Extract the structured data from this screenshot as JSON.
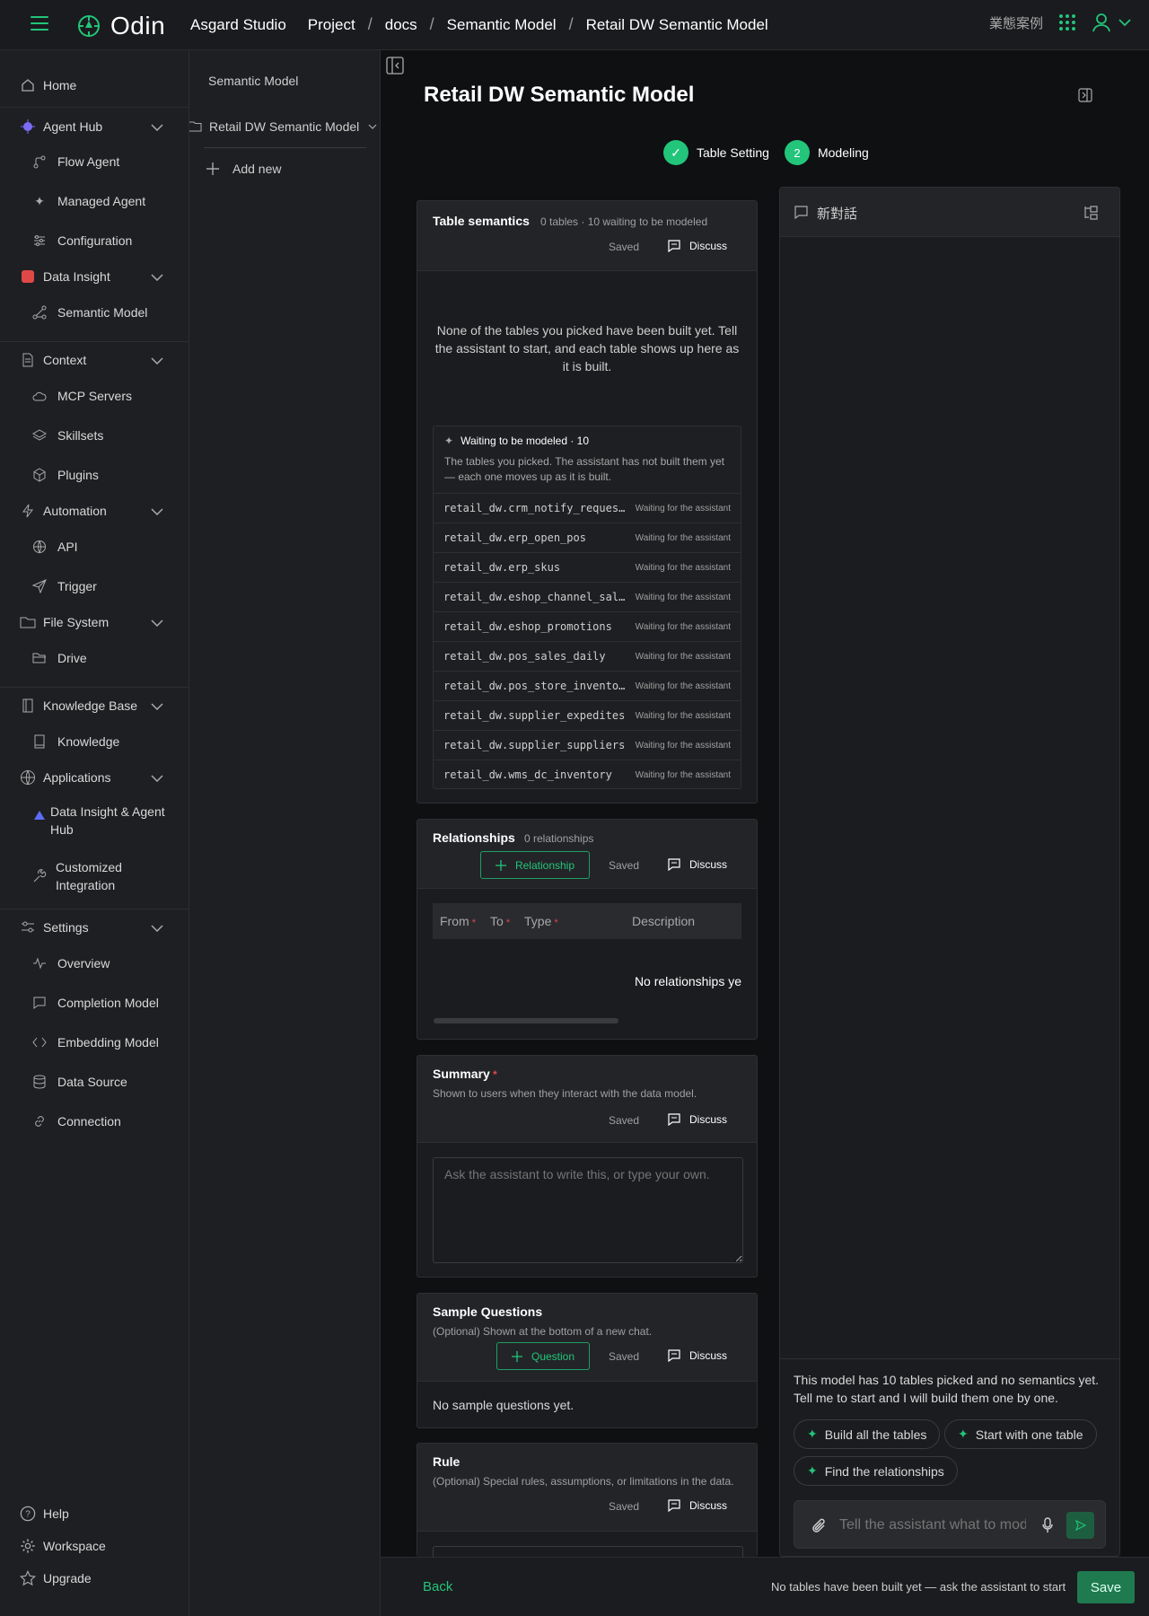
{
  "header": {
    "brand": "Odin",
    "studio": "Asgard Studio",
    "breadcrumbs": [
      "Project",
      "docs",
      "Semantic Model",
      "Retail DW Semantic Model"
    ],
    "right_label": "業態案例"
  },
  "sidebar": {
    "items": [
      {
        "label": "Home",
        "icon": "home-icon"
      },
      {
        "label": "Agent Hub",
        "icon": "agent-hub-icon"
      },
      {
        "label": "Flow Agent",
        "icon": "flow-icon"
      },
      {
        "label": "Managed Agent",
        "icon": "sparkle-icon"
      },
      {
        "label": "Configuration",
        "icon": "sliders-icon"
      },
      {
        "label": "Data Insight",
        "icon": "data-insight-icon"
      },
      {
        "label": "Semantic Model",
        "icon": "graph-icon"
      },
      {
        "label": "Context",
        "icon": "document-icon"
      },
      {
        "label": "MCP Servers",
        "icon": "cloud-icon"
      },
      {
        "label": "Skillsets",
        "icon": "layers-icon"
      },
      {
        "label": "Plugins",
        "icon": "cube-icon"
      },
      {
        "label": "Automation",
        "icon": "bolt-icon"
      },
      {
        "label": "API",
        "icon": "globe-icon"
      },
      {
        "label": "Trigger",
        "icon": "send-icon"
      },
      {
        "label": "File System",
        "icon": "folder-icon"
      },
      {
        "label": "Drive",
        "icon": "folder-open-icon"
      },
      {
        "label": "Knowledge Base",
        "icon": "book-icon"
      },
      {
        "label": "Knowledge",
        "icon": "book-small-icon"
      },
      {
        "label": "Applications",
        "icon": "globe-icon"
      },
      {
        "label": "Data Insight & Agent Hub",
        "icon": "triangle-icon"
      },
      {
        "label": "Customized Integration",
        "icon": "wrench-icon"
      },
      {
        "label": "Settings",
        "icon": "settings-sliders-icon"
      },
      {
        "label": "Overview",
        "icon": "pulse-icon"
      },
      {
        "label": "Completion Model",
        "icon": "chat-icon"
      },
      {
        "label": "Embedding Model",
        "icon": "code-icon"
      },
      {
        "label": "Data Source",
        "icon": "database-icon"
      },
      {
        "label": "Connection",
        "icon": "link-icon"
      }
    ],
    "bottom": [
      {
        "label": "Help",
        "icon": "help-icon"
      },
      {
        "label": "Workspace",
        "icon": "gear-icon"
      },
      {
        "label": "Upgrade",
        "icon": "star-icon"
      }
    ]
  },
  "tree": {
    "header": "Semantic Model",
    "item": "Retail DW Semantic Model",
    "add_new": "Add new"
  },
  "page": {
    "title": "Retail DW Semantic Model",
    "steps": [
      {
        "index": "✓",
        "label": "Table Setting"
      },
      {
        "index": "2",
        "label": "Modeling"
      }
    ]
  },
  "table_semantics": {
    "title": "Table semantics",
    "subtitle": "0 tables · 10 waiting to be modeled",
    "saved": "Saved",
    "discuss": "Discuss",
    "empty_text": "None of the tables you picked have been built yet. Tell the assistant to start, and each table shows up here as it is built.",
    "waiting_title": "Waiting to be modeled · 10",
    "waiting_desc": "The tables you picked. The assistant has not built them yet — each one moves up as it is built.",
    "status_label": "Waiting for the assistant",
    "tables": [
      "retail_dw.crm_notify_requests",
      "retail_dw.erp_open_pos",
      "retail_dw.erp_skus",
      "retail_dw.eshop_channel_sales",
      "retail_dw.eshop_promotions",
      "retail_dw.pos_sales_daily",
      "retail_dw.pos_store_inventory",
      "retail_dw.supplier_expedites",
      "retail_dw.supplier_suppliers",
      "retail_dw.wms_dc_inventory"
    ]
  },
  "relationships": {
    "title": "Relationships",
    "subtitle": "0 relationships",
    "add_label": "Relationship",
    "saved": "Saved",
    "discuss": "Discuss",
    "columns": [
      "From",
      "To",
      "Type",
      "Description"
    ],
    "empty": "No relationships ye"
  },
  "summary": {
    "title": "Summary",
    "subtitle": "Shown to users when they interact with the data model.",
    "saved": "Saved",
    "discuss": "Discuss",
    "placeholder": "Ask the assistant to write this, or type your own."
  },
  "sample_questions": {
    "title": "Sample Questions",
    "subtitle": "(Optional) Shown at the bottom of a new chat.",
    "add_label": "Question",
    "saved": "Saved",
    "discuss": "Discuss",
    "empty": "No sample questions yet."
  },
  "rule": {
    "title": "Rule",
    "subtitle": "(Optional) Special rules, assumptions, or limitations in the data.",
    "saved": "Saved",
    "discuss": "Discuss"
  },
  "chat": {
    "title": "新對話",
    "message": "This model has 10 tables picked and no semantics yet. Tell me to start and I will build them one by one.",
    "chips": [
      "Build all the tables",
      "Start with one table",
      "Find the relationships"
    ],
    "input_placeholder": "Tell the assistant what to model"
  },
  "footer": {
    "back": "Back",
    "status": "No tables have been built yet — ask the assistant to start",
    "save": "Save"
  },
  "colors": {
    "accent": "#22c57a",
    "background": "#0f1012",
    "panel": "#1b1c1f"
  }
}
